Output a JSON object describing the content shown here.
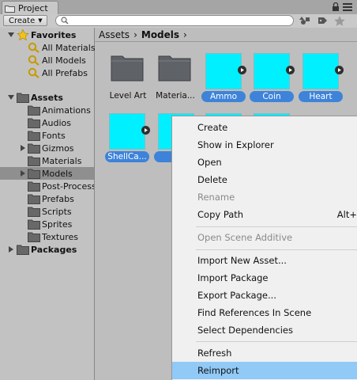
{
  "window": {
    "tab_label": "Project"
  },
  "toolbar": {
    "create_label": "Create",
    "search_value": ""
  },
  "tree": {
    "favorites": {
      "label": "Favorites",
      "items": [
        "All Materials",
        "All Models",
        "All Prefabs"
      ]
    },
    "assets": {
      "label": "Assets",
      "items": [
        "Animations",
        "Audios",
        "Fonts",
        "Gizmos",
        "Materials",
        "Models",
        "Post-Processing",
        "Prefabs",
        "Scripts",
        "Sprites",
        "Textures"
      ],
      "selected": "Models"
    },
    "packages": {
      "label": "Packages"
    }
  },
  "breadcrumb": {
    "root": "Assets",
    "current": "Models"
  },
  "assets_grid": [
    {
      "name": "Level Art",
      "kind": "folder",
      "selected": false
    },
    {
      "name": "Materia...",
      "kind": "folder",
      "selected": false
    },
    {
      "name": "Ammo",
      "kind": "model",
      "selected": true
    },
    {
      "name": "Coin",
      "kind": "model",
      "selected": true
    },
    {
      "name": "Heart",
      "kind": "model",
      "selected": true
    },
    {
      "name": "ShellCa...",
      "kind": "model",
      "selected": true
    },
    {
      "name": "",
      "kind": "model",
      "selected": true
    }
  ],
  "context_menu": {
    "items": [
      {
        "label": "Create",
        "enabled": true,
        "shortcut": ""
      },
      {
        "label": "Show in Explorer",
        "enabled": true,
        "shortcut": ""
      },
      {
        "label": "Open",
        "enabled": true,
        "shortcut": ""
      },
      {
        "label": "Delete",
        "enabled": true,
        "shortcut": ""
      },
      {
        "label": "Rename",
        "enabled": false,
        "shortcut": ""
      },
      {
        "label": "Copy Path",
        "enabled": true,
        "shortcut": "Alt+"
      },
      {
        "label": "Open Scene Additive",
        "enabled": false,
        "shortcut": ""
      },
      {
        "label": "Import New Asset...",
        "enabled": true,
        "shortcut": ""
      },
      {
        "label": "Import Package",
        "enabled": true,
        "shortcut": ""
      },
      {
        "label": "Export Package...",
        "enabled": true,
        "shortcut": ""
      },
      {
        "label": "Find References In Scene",
        "enabled": true,
        "shortcut": ""
      },
      {
        "label": "Select Dependencies",
        "enabled": true,
        "shortcut": ""
      },
      {
        "label": "Refresh",
        "enabled": true,
        "shortcut": ""
      },
      {
        "label": "Reimport",
        "enabled": true,
        "shortcut": "",
        "highlighted": true
      }
    ]
  },
  "colors": {
    "selection_blue": "#3d83d9",
    "model_cyan": "#00f0ff",
    "menu_highlight": "#91c9f7"
  }
}
